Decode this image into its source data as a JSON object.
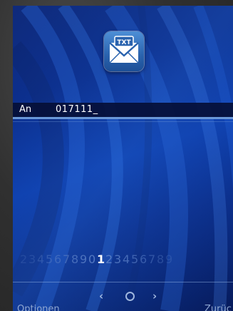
{
  "compose": {
    "app_icon": "txt-envelope-icon",
    "app_icon_text": "TXT",
    "to_label": "An",
    "to_value": "017111_"
  },
  "digit_picker": {
    "digits": [
      "2",
      "3",
      "4",
      "5",
      "6",
      "7",
      "8",
      "9",
      "0",
      "1",
      "2",
      "3",
      "4",
      "5",
      "6",
      "7",
      "8",
      "9"
    ],
    "selected_index": 9
  },
  "navigation": {
    "left": "‹",
    "right": "›"
  },
  "softkeys": {
    "left": "Optionen",
    "right": "Zurüc"
  },
  "colors": {
    "background": "#0b3aa8",
    "accent": "#6a98d8",
    "selected_digit": "#ffffff",
    "dim_digit": "#5a7fc6"
  }
}
